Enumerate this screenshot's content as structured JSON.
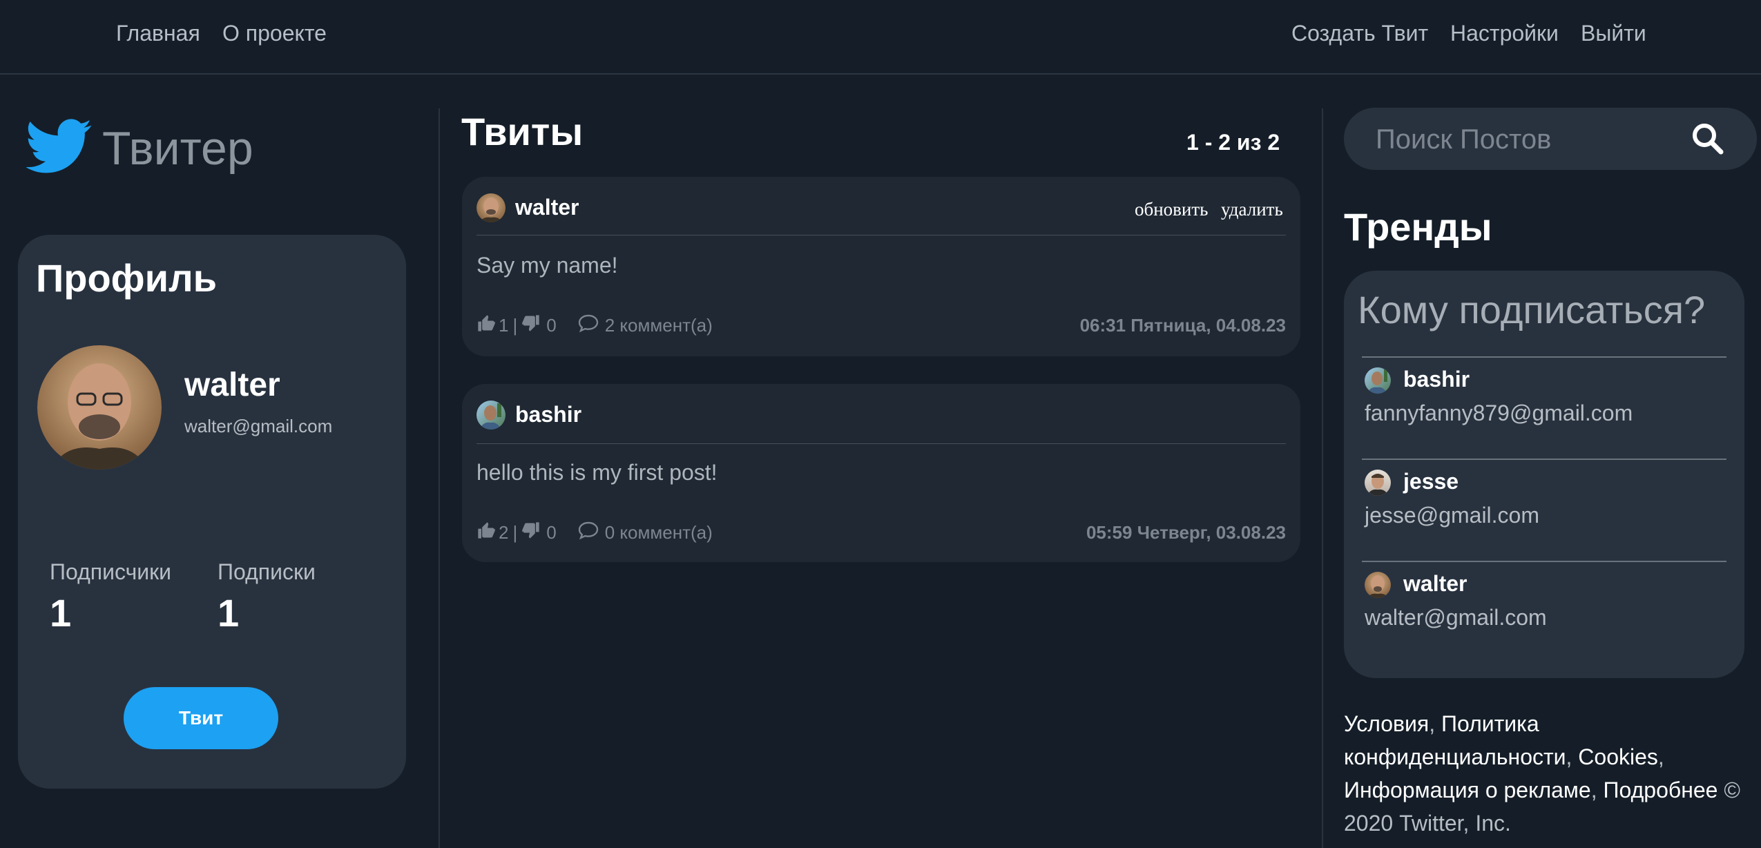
{
  "nav": {
    "home": "Главная",
    "about": "О проекте",
    "create_tweet": "Создать Твит",
    "settings": "Настройки",
    "logout": "Выйти"
  },
  "brand": {
    "name": "Твитер",
    "icon": "twitter-bird-icon"
  },
  "profile": {
    "title": "Профиль",
    "name": "walter",
    "email": "walter@gmail.com",
    "followers_label": "Подписчики",
    "followers_count": "1",
    "following_label": "Подписки",
    "following_count": "1",
    "tweet_button": "Твит"
  },
  "feed": {
    "title": "Твиты",
    "pagination": "1 - 2 из 2",
    "tweets": [
      {
        "author": "walter",
        "update_label": "обновить",
        "delete_label": "удалить",
        "text": "Say my name!",
        "likes": "1",
        "dislikes": "0",
        "comments": "2 коммент(а)",
        "date": "06:31 Пятница, 04.08.23"
      },
      {
        "author": "bashir",
        "text": "hello this is my first post!",
        "likes": "2",
        "dislikes": "0",
        "comments": "0 коммент(а)",
        "date": "05:59 Четверг, 03.08.23"
      }
    ]
  },
  "search": {
    "placeholder": "Поиск Постов",
    "icon": "search-icon"
  },
  "trends": {
    "title": "Тренды",
    "who_to_follow_title": "Кому подписаться?",
    "users": [
      {
        "name": "bashir",
        "email": "fannyfanny879@gmail.com"
      },
      {
        "name": "jesse",
        "email": "jesse@gmail.com"
      },
      {
        "name": "walter",
        "email": "walter@gmail.com"
      }
    ]
  },
  "footer": {
    "terms": "Условия",
    "privacy": "Политика конфиденциальности",
    "cookies": "Cookies",
    "ads": "Информация о рекламе",
    "more": "Подробнее",
    "copyright": "© 2020 Twitter, Inc."
  },
  "colors": {
    "background": "#151e28",
    "card": "#28323f",
    "tweet_card": "#1f2833",
    "accent": "#1da1f2"
  }
}
